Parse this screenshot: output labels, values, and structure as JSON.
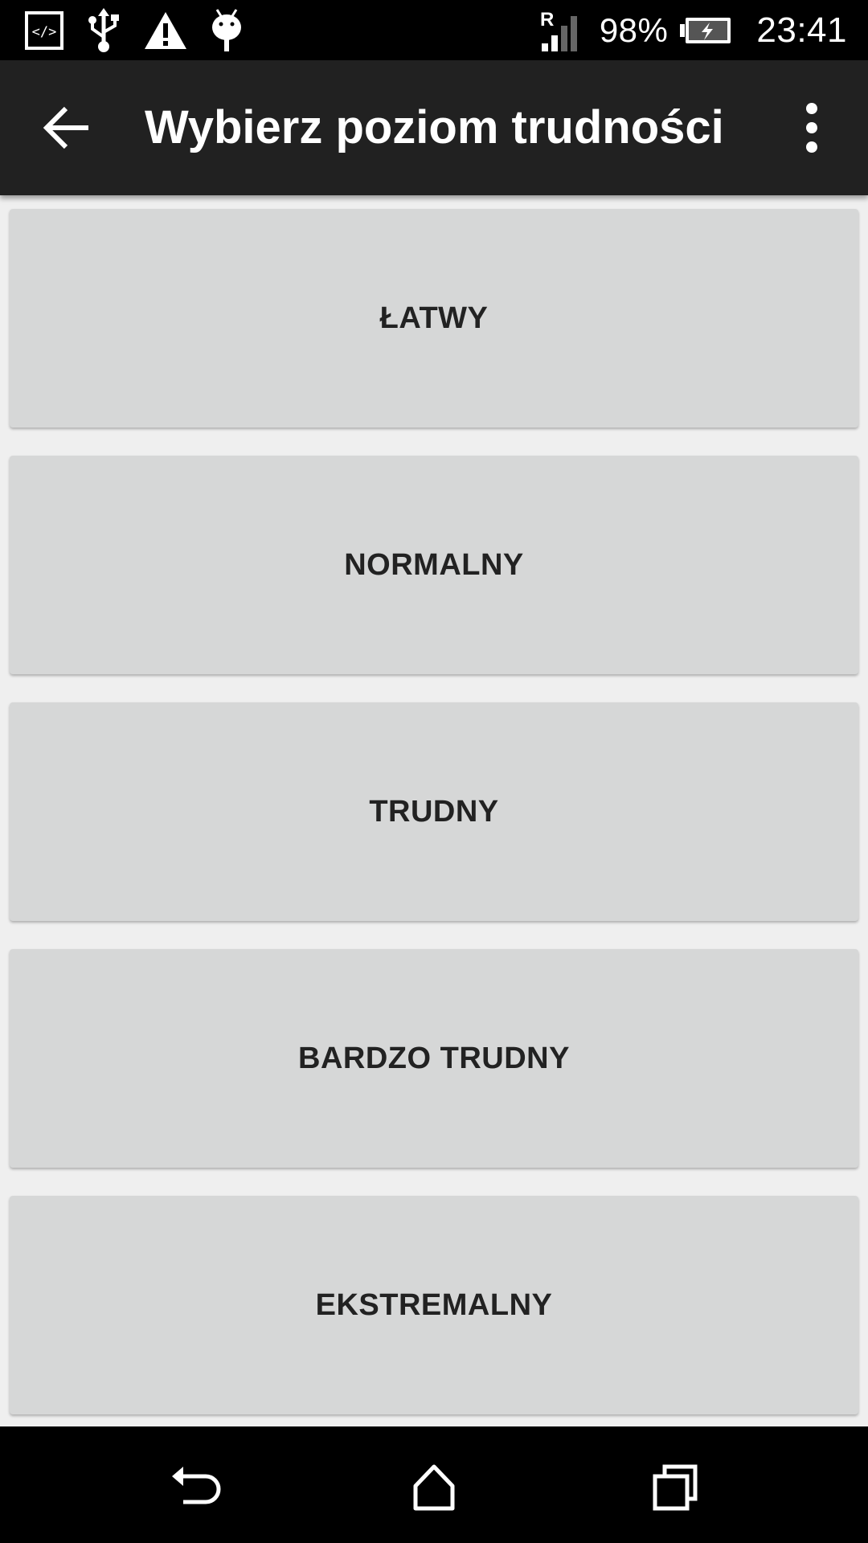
{
  "status_bar": {
    "left_icons": [
      "developer-code-icon",
      "usb-icon",
      "warning-icon",
      "android-debug-icon"
    ],
    "roaming_indicator": "R",
    "battery_percent": "98%",
    "time": "23:41"
  },
  "app_bar": {
    "title": "Wybierz poziom trudności",
    "back_icon": "arrow-back-icon",
    "menu_icon": "more-vert-icon"
  },
  "levels": [
    {
      "label": "ŁATWY"
    },
    {
      "label": "NORMALNY"
    },
    {
      "label": "TRUDNY"
    },
    {
      "label": "BARDZO TRUDNY"
    },
    {
      "label": "EKSTREMALNY"
    }
  ],
  "nav_bar": {
    "icons": [
      "back-nav-icon",
      "home-nav-icon",
      "recents-nav-icon"
    ]
  },
  "colors": {
    "app_bar": "#212121",
    "background": "#efefef",
    "button": "#d6d7d7",
    "button_text": "#222222"
  }
}
